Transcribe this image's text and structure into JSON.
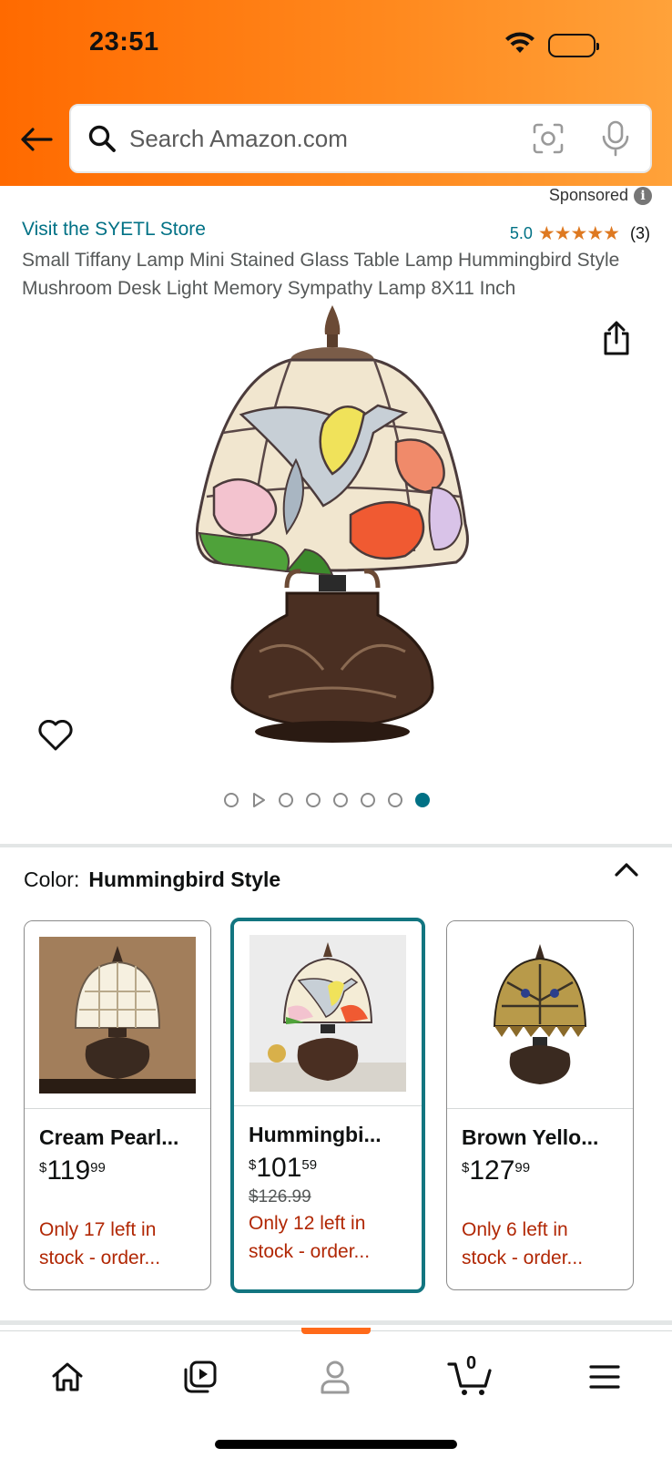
{
  "status_bar": {
    "time": "23:51"
  },
  "search": {
    "placeholder": "Search Amazon.com"
  },
  "product": {
    "sponsored_label": "Sponsored",
    "store_link": "Visit the SYETL Store",
    "rating_value": "5.0",
    "rating_stars": 5,
    "rating_count": "(3)",
    "title": "Small Tiffany Lamp Mini Stained Glass Table Lamp Hummingbird Style Mushroom Desk Light Memory Sympathy Lamp 8X11 Inch",
    "image_count": 8,
    "active_image_index": 7
  },
  "color": {
    "label": "Color:",
    "selected_value": "Hummingbird Style",
    "variants": [
      {
        "name": "Cream Pearl...",
        "currency": "$",
        "price_whole": "119",
        "price_cents": "99",
        "list_price": "",
        "stock_line1": "Only 17 left in",
        "stock_line2": "stock - order...",
        "selected": false
      },
      {
        "name": "Hummingbi...",
        "currency": "$",
        "price_whole": "101",
        "price_cents": "59",
        "list_price": "$126.99",
        "stock_line1": "Only 12 left in",
        "stock_line2": "stock - order...",
        "selected": true
      },
      {
        "name": "Brown Yello...",
        "currency": "$",
        "price_whole": "127",
        "price_cents": "99",
        "list_price": "",
        "stock_line1": "Only 6 left in",
        "stock_line2": "stock - order...",
        "selected": false
      }
    ]
  },
  "bottom_nav": {
    "items": [
      "home-icon",
      "video-icon",
      "account-icon",
      "cart-icon",
      "menu-icon"
    ],
    "active": "account-icon",
    "cart_count": "0"
  },
  "colors": {
    "header_start": "#ff6a00",
    "header_end": "#ffa23a",
    "link": "#007185",
    "star": "#de7921",
    "stock": "#b12704",
    "selected_border": "#127580"
  }
}
